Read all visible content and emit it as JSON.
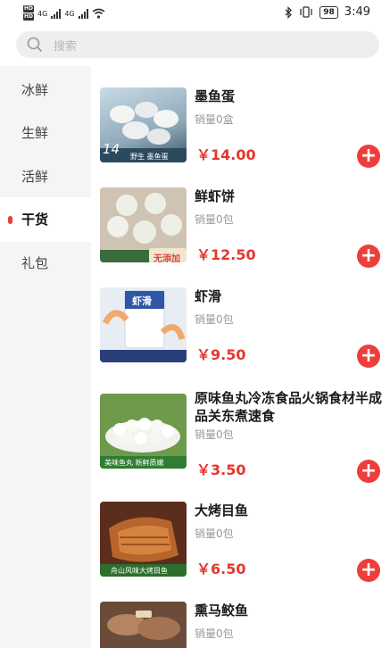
{
  "status_bar": {
    "network_1": "4G",
    "network_2": "4G",
    "battery": "98",
    "time": "3:49"
  },
  "search": {
    "placeholder": "搜索"
  },
  "sidebar": {
    "items": [
      {
        "label": "冰鲜",
        "active": false
      },
      {
        "label": "生鲜",
        "active": false
      },
      {
        "label": "活鲜",
        "active": false
      },
      {
        "label": "干货",
        "active": true
      },
      {
        "label": "礼包",
        "active": false
      }
    ]
  },
  "products": [
    {
      "name": "墨鱼蛋",
      "sales": "销量0盒",
      "price": "￥14.00",
      "image_caption": "野生 墨鱼蛋",
      "image_badge": "14"
    },
    {
      "name": "鲜虾饼",
      "sales": "销量0包",
      "price": "￥12.50",
      "image_caption": "无添加"
    },
    {
      "name": "虾滑",
      "sales": "销量0包",
      "price": "￥9.50",
      "image_caption": "虾滑"
    },
    {
      "name": "原味鱼丸冷冻食品火锅食材半成品关东煮速食",
      "sales": "销量0包",
      "price": "￥3.50",
      "image_caption": "美味鱼丸 新鲜质嫩"
    },
    {
      "name": "大烤目鱼",
      "sales": "销量0包",
      "price": "￥6.50",
      "image_caption": "舟山风味大烤目鱼"
    },
    {
      "name": "熏马鲛鱼",
      "sales": "销量0包",
      "price": ""
    }
  ]
}
